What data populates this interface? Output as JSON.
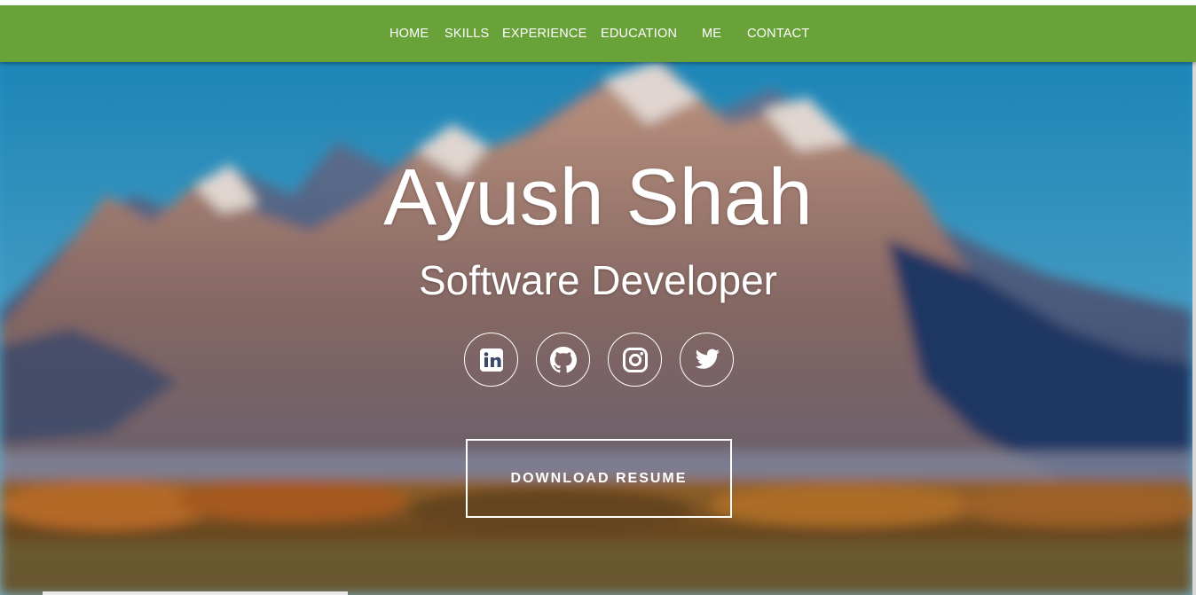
{
  "nav": {
    "items": [
      {
        "label": "HOME"
      },
      {
        "label": "SKILLS"
      },
      {
        "label": "EXPERIENCE"
      },
      {
        "label": "EDUCATION"
      },
      {
        "label": "ME"
      },
      {
        "label": "CONTACT"
      }
    ],
    "bar_color": "#6aa23a"
  },
  "hero": {
    "name": "Ayush Shah",
    "role": "Software Developer",
    "background": "blurred mountain landscape with autumn trees",
    "social_icons": [
      "linkedin-icon",
      "github-icon",
      "instagram-icon",
      "twitter-icon"
    ],
    "resume_label": "DOWNLOAD RESUME"
  }
}
